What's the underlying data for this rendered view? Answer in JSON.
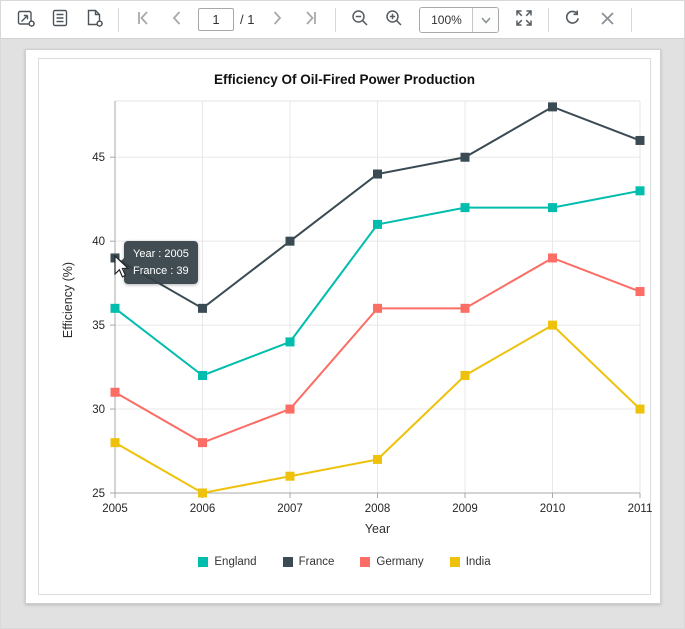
{
  "toolbar": {
    "page_number": "1",
    "page_count_label": "/ 1",
    "zoom_level": "100%"
  },
  "tooltip": {
    "line1": "Year : 2005",
    "line2": "France : 39"
  },
  "colors": {
    "toolbar_icon": "#4d555b",
    "toolbar_icon_disabled": "#a9a9a9",
    "viewer_background": "#e1e1e1",
    "tooltip_background": "#34404 6",
    "axis_line": "#a9a9a9",
    "gridline": "#e8e8e8"
  },
  "chart_data": {
    "type": "line",
    "title": "Efficiency Of Oil-Fired Power Production",
    "xlabel": "Year",
    "ylabel": "Efficiency (%)",
    "x": [
      2005,
      2006,
      2007,
      2008,
      2009,
      2010,
      2011
    ],
    "series": [
      {
        "name": "England",
        "color": "#00bdae",
        "values": [
          36,
          32,
          34,
          41,
          42,
          42,
          43
        ]
      },
      {
        "name": "France",
        "color": "#3a4b53",
        "values": [
          39,
          36,
          40,
          44,
          45,
          48,
          46
        ]
      },
      {
        "name": "Germany",
        "color": "#fb6d65",
        "values": [
          31,
          28,
          30,
          36,
          36,
          39,
          37
        ]
      },
      {
        "name": "India",
        "color": "#eec20b",
        "values": [
          28,
          25,
          26,
          27,
          32,
          35,
          30
        ]
      }
    ],
    "ylim": [
      25,
      48.35
    ],
    "yticks": [
      25,
      30,
      35,
      40,
      45
    ],
    "grid": true,
    "legend_position": "bottom",
    "marker": "square",
    "hovered_point": {
      "series": "France",
      "x": 2005,
      "value": 39
    }
  }
}
